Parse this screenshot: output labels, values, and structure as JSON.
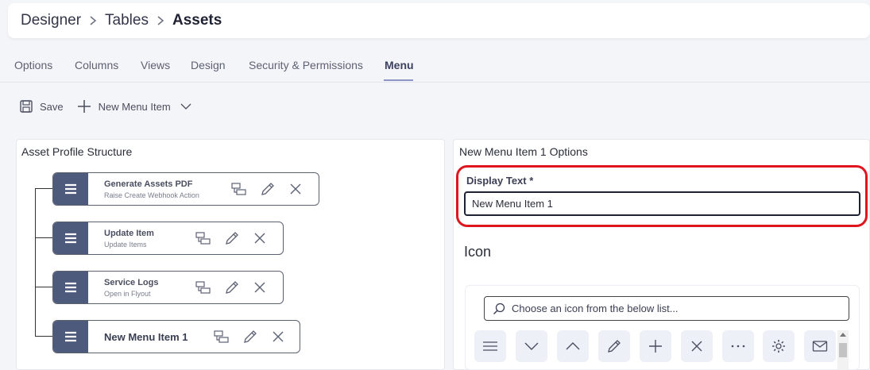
{
  "breadcrumb": {
    "items": [
      "Designer",
      "Tables",
      "Assets"
    ]
  },
  "tabs": [
    "Options",
    "Columns",
    "Views",
    "Design",
    "Security & Permissions",
    "Menu"
  ],
  "active_tab": "Menu",
  "toolbar": {
    "save_label": "Save",
    "new_item_label": "New Menu Item"
  },
  "left_panel": {
    "title": "Asset Profile Structure",
    "items": [
      {
        "title": "Generate Assets PDF",
        "subtitle": "Raise Create Webhook Action"
      },
      {
        "title": "Update Item",
        "subtitle": "Update Items"
      },
      {
        "title": "Service Logs",
        "subtitle": "Open in Flyout"
      },
      {
        "title": "New Menu Item 1",
        "subtitle": ""
      }
    ]
  },
  "right_panel": {
    "title": "New Menu Item 1 Options",
    "display_text_label": "Display Text *",
    "display_text_value": "New Menu Item 1",
    "icon_section_title": "Icon",
    "icon_search_placeholder": "Choose an icon from the below list...",
    "icon_tiles": [
      "menu-icon",
      "chevron-down-icon",
      "chevron-up-icon",
      "pencil-icon",
      "plus-icon",
      "close-icon",
      "more-icon",
      "gear-icon",
      "mail-icon"
    ]
  },
  "colors": {
    "handle": "#4e5a7c",
    "highlight": "#e0161f",
    "accent": "#8e95c4"
  }
}
